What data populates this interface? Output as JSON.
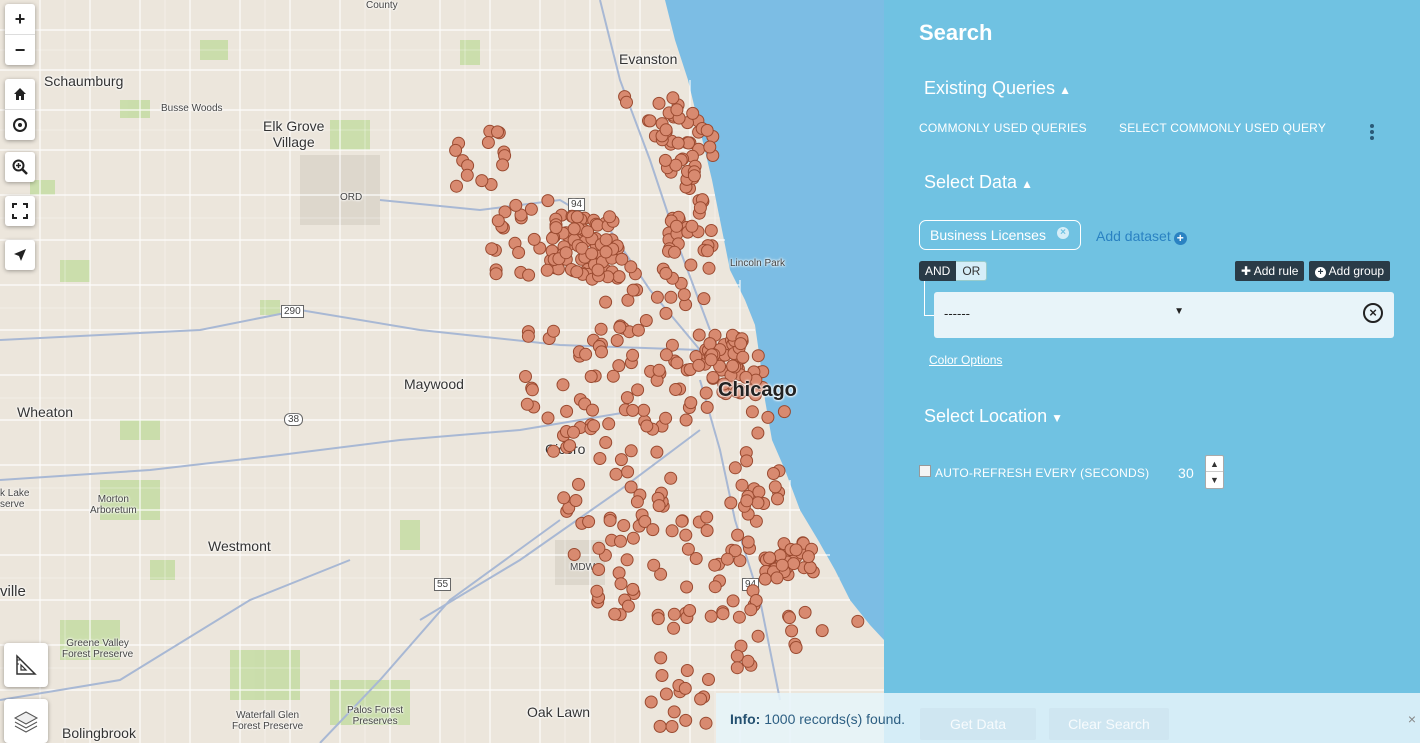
{
  "map": {
    "labels": {
      "county": "County",
      "evanston": "Evanston",
      "schaumburg": "Schaumburg",
      "busse_woods": "Busse Woods",
      "elk_grove": "Elk Grove\nVillage",
      "ord": "ORD",
      "maywood": "Maywood",
      "wheaton": "Wheaton",
      "cicero": "Cicero",
      "chicago": "Chicago",
      "lincoln_park": "Lincoln Park",
      "lake": "k Lake\nserve",
      "morton": "Morton\nArboretum",
      "westmont": "Westmont",
      "mdw": "MDW",
      "ville": "ville",
      "greene_valley": "Greene Valley\nForest Preserve",
      "waterfall_glen": "Waterfall Glen\nForest Preserve",
      "palos": "Palos Forest\nPreserves",
      "oak_lawn": "Oak Lawn",
      "bolingbrook": "Bolingbrook",
      "hwy_94a": "94",
      "hwy_290": "290",
      "hwy_38": "38",
      "hwy_55": "55",
      "hwy_94b": "94"
    },
    "controls": {
      "zoom_in": "+",
      "zoom_out": "−"
    },
    "marker_color": "#d88a70",
    "marker_stroke": "#9a4a30"
  },
  "panel": {
    "title": "Search",
    "existing_queries": "Existing Queries",
    "commonly_used_label": "COMMONLY USED QUERIES",
    "commonly_used_select": "SELECT COMMONLY USED QUERY",
    "select_data": "Select Data",
    "dataset_chip": "Business Licenses",
    "add_dataset": "Add dataset",
    "and_label": "AND",
    "or_label": "OR",
    "add_rule": "Add rule",
    "add_group": "Add group",
    "rule_select_value": "------",
    "color_options": "Color Options",
    "select_location": "Select Location",
    "auto_refresh_label": "AUTO-REFRESH EVERY (SECONDS)",
    "auto_refresh_value": "30"
  },
  "footer": {
    "info_prefix": "Info:",
    "info_text": " 1000 records(s) found.",
    "get_data": "Get Data",
    "clear_search": "Clear Search",
    "close": "×"
  }
}
